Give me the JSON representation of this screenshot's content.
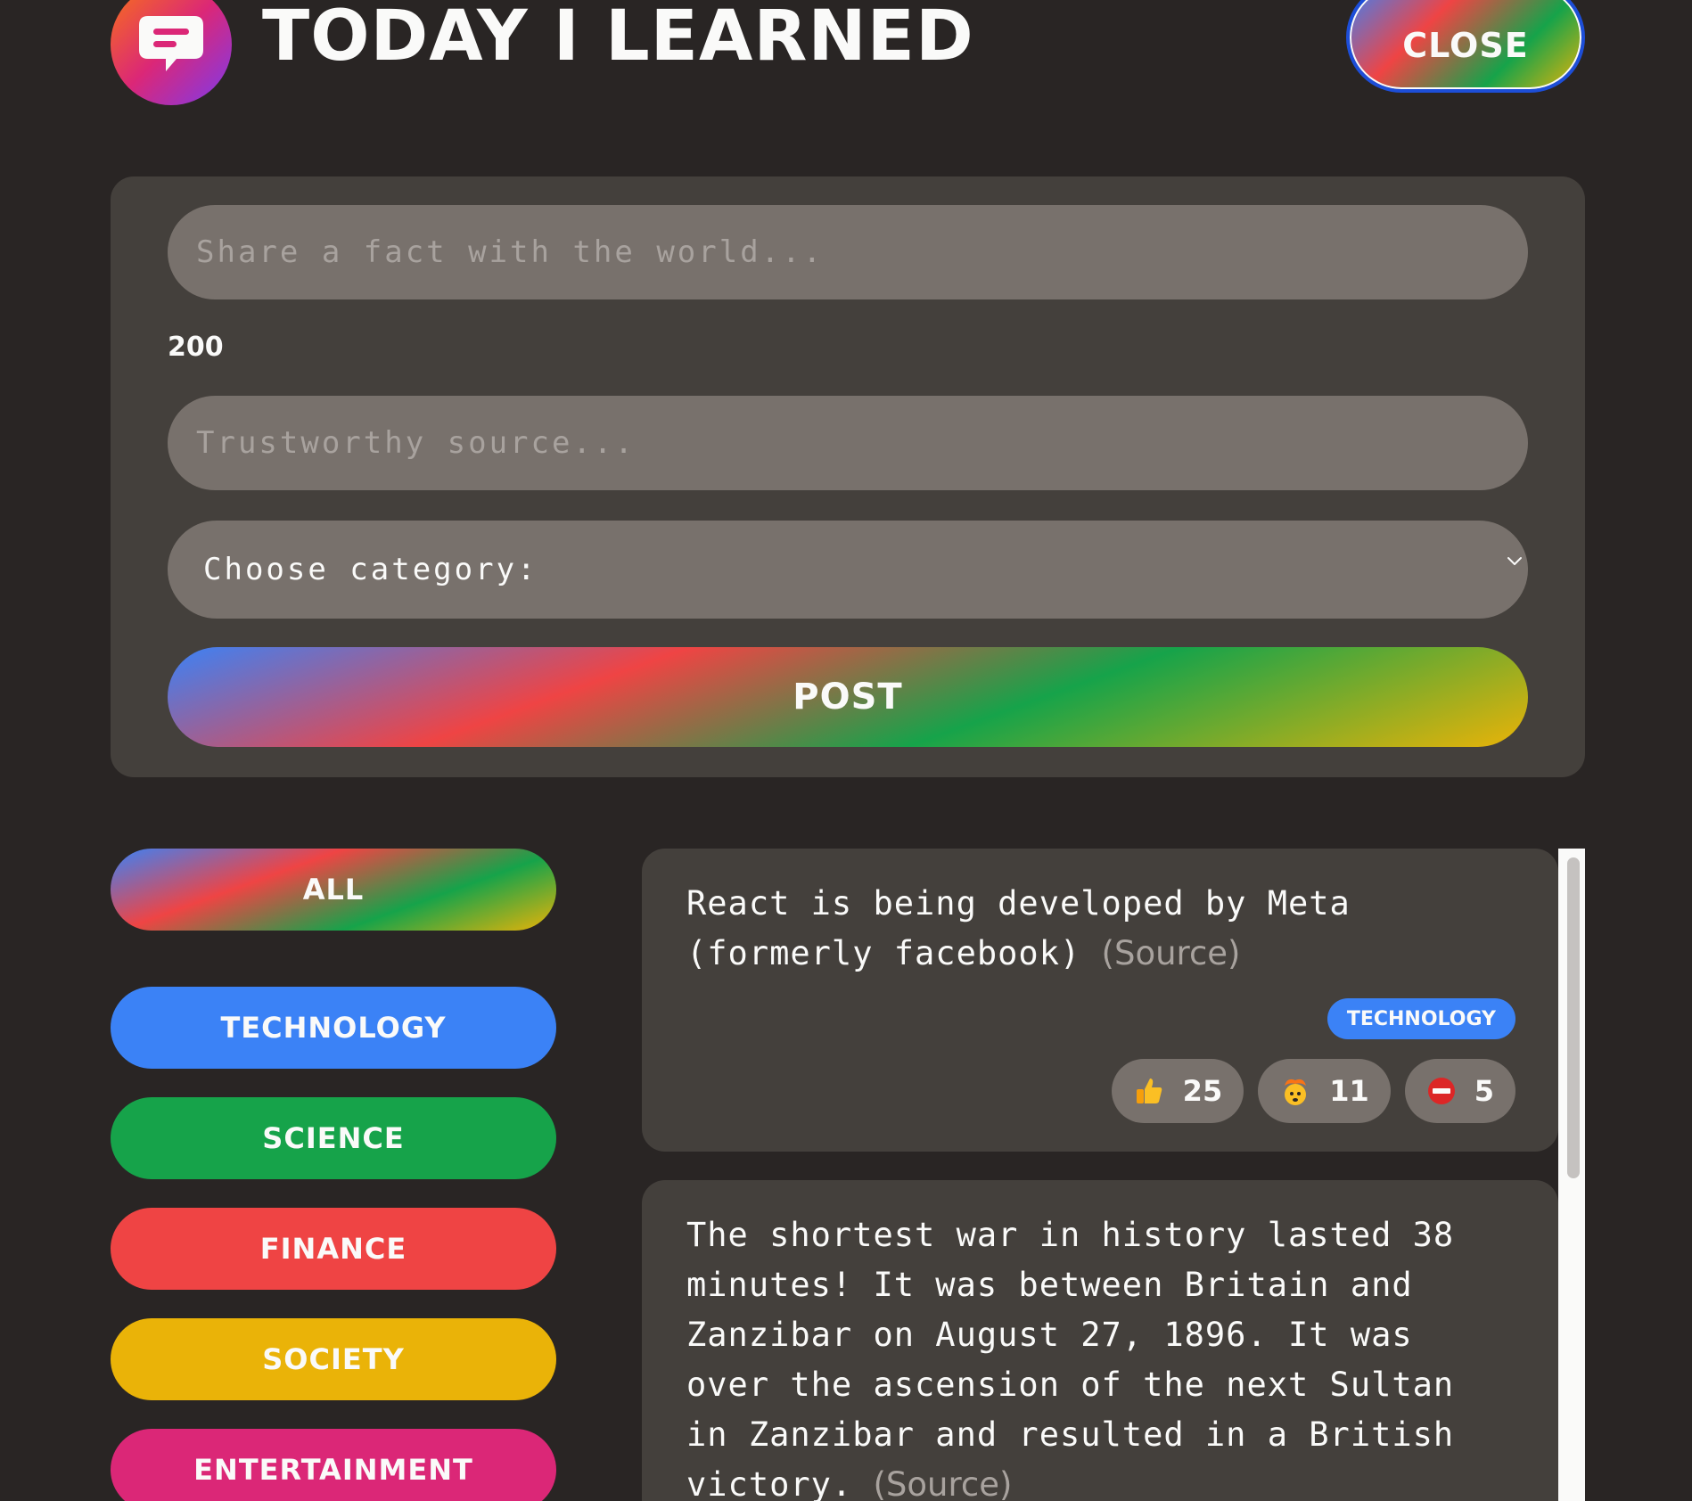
{
  "header": {
    "title": "Today I Learned",
    "close_label": "Close",
    "logo_icon": "speech-bubble-icon"
  },
  "form": {
    "fact_placeholder": "Share a fact with the world...",
    "fact_value": "",
    "char_count": "200",
    "source_placeholder": "Trustworthy source...",
    "source_value": "",
    "category_selected": "Choose category:",
    "post_label": "Post"
  },
  "categories": {
    "all": "All",
    "items": [
      {
        "label": "Technology",
        "color": "#3b82f6"
      },
      {
        "label": "Science",
        "color": "#16a34a"
      },
      {
        "label": "Finance",
        "color": "#ef4444"
      },
      {
        "label": "Society",
        "color": "#eab308"
      },
      {
        "label": "Entertainment",
        "color": "#db2777"
      }
    ]
  },
  "facts": [
    {
      "text": "React is being developed by Meta (formerly facebook)",
      "source_label": "(Source)",
      "category": "Technology",
      "category_color": "#3b82f6",
      "votes": {
        "interesting": "25",
        "mindblowing": "11",
        "false": "5"
      }
    },
    {
      "text": "The shortest war in history lasted 38 minutes! It was between Britain and Zanzibar on August 27, 1896. It was over the ascension of the next Sultan in Zanzibar and resulted in a British victory.",
      "source_label": "(Source)"
    }
  ],
  "colors": {
    "background": "#292524",
    "panel": "#44403c",
    "field": "#78716c",
    "text": "#fafaf9"
  }
}
